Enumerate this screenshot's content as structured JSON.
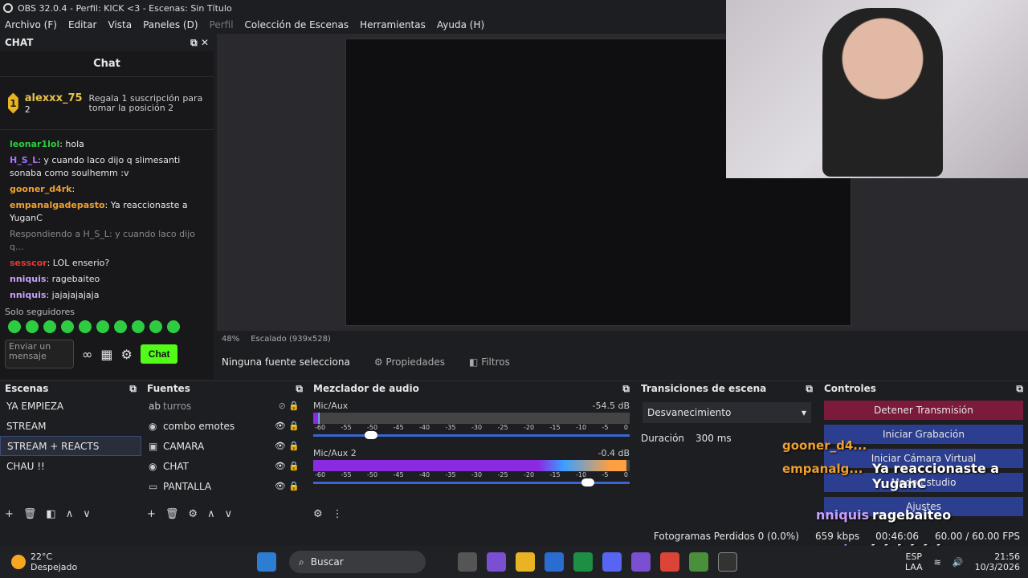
{
  "window": {
    "title": "OBS 32.0.4 - Perfil: KICK <3 - Escenas: Sin Título"
  },
  "menu": [
    "Archivo (F)",
    "Editar",
    "Vista",
    "Paneles (D)",
    "Perfil",
    "Colección de Escenas",
    "Herramientas",
    "Ayuda (H)"
  ],
  "chat": {
    "dock_title": "CHAT",
    "title": "Chat",
    "pinned": {
      "rank": "1",
      "user": "alexxx_75",
      "count": "2",
      "text": "Regala 1 suscripción para tomar la posición 2"
    },
    "messages": [
      {
        "user": "leonar1lol",
        "color": "#2ecc40",
        "text": ": hola"
      },
      {
        "user": "H_S_L",
        "color": "#a970ff",
        "text": ": y cuando laco dijo q slimesanti sonaba como soulhemm :v"
      },
      {
        "user": "gooner_d4rk",
        "color": "#f0a030",
        "text": ":"
      },
      {
        "user": "empanalgadepasto",
        "color": "#f0a030",
        "text": ": Ya reaccionaste a YuganC"
      },
      {
        "user": "",
        "color": "#888",
        "text": "Respondiendo a H_S_L: y cuando laco dijo q..."
      },
      {
        "user": "sesscor",
        "color": "#e53935",
        "text": ": LOL enserio?"
      },
      {
        "user": "nniquis",
        "color": "#c8a0ff",
        "text": ": ragebaiteo"
      },
      {
        "user": "nniquis",
        "color": "#c8a0ff",
        "text": ": jajajajajaja"
      }
    ],
    "followers_only": "Solo seguidores",
    "input_placeholder": "Enviar un mensaje",
    "send_label": "Chat"
  },
  "preview": {
    "zoom": "48%",
    "scale": "Escalado (939x528)"
  },
  "source_bar": {
    "none_selected": "Ninguna fuente selecciona",
    "properties": "Propiedades",
    "filters": "Filtros"
  },
  "scenes": {
    "title": "Escenas",
    "items": [
      "YA EMPIEZA",
      "STREAM",
      "STREAM + REACTS",
      "CHAU !!"
    ]
  },
  "sources": {
    "title": "Fuentes",
    "items": [
      "turros",
      "combo emotes",
      "CAMARA",
      "CHAT",
      "PANTALLA"
    ]
  },
  "mixer": {
    "title": "Mezclador de audio",
    "tracks": [
      {
        "name": "Mic/Aux",
        "db": "-54.5 dB",
        "level": 0.0
      },
      {
        "name": "Mic/Aux 2",
        "db": "-0.4 dB",
        "level": 0.99
      }
    ],
    "ticks": [
      "-60",
      "-55",
      "-50",
      "-45",
      "-40",
      "-35",
      "-30",
      "-25",
      "-20",
      "-15",
      "-10",
      "-5",
      "0"
    ]
  },
  "transitions": {
    "title": "Transiciones de escena",
    "selected": "Desvanecimiento",
    "duration_label": "Duración",
    "duration": "300 ms"
  },
  "controls": {
    "title": "Controles",
    "stop_stream": "Detener Transmisión",
    "start_rec": "Iniciar Grabación",
    "start_vcam": "Iniciar Cámara Virtual",
    "studio": "Modo Estudio",
    "settings": "Ajustes"
  },
  "overlay": {
    "u1": "gooner_d4...",
    "u2": "empanalg...",
    "m2": "Ya reaccionaste a YuganC",
    "u3": "nniquis",
    "m3": "ragebaiteo",
    "u4": "nniquis",
    "m4": "jajajajajaja"
  },
  "status": {
    "dropped": "Fotogramas Perdidos 0 (0.0%)",
    "kbps": "659 kbps",
    "time": "00:46:06",
    "fps": "60.00 / 60.00 FPS"
  },
  "taskbar": {
    "temp": "22°C",
    "weather": "Despejado",
    "search": "Buscar",
    "lang1": "ESP",
    "lang2": "LAA",
    "time": "21:56",
    "date": "10/3/2026"
  }
}
